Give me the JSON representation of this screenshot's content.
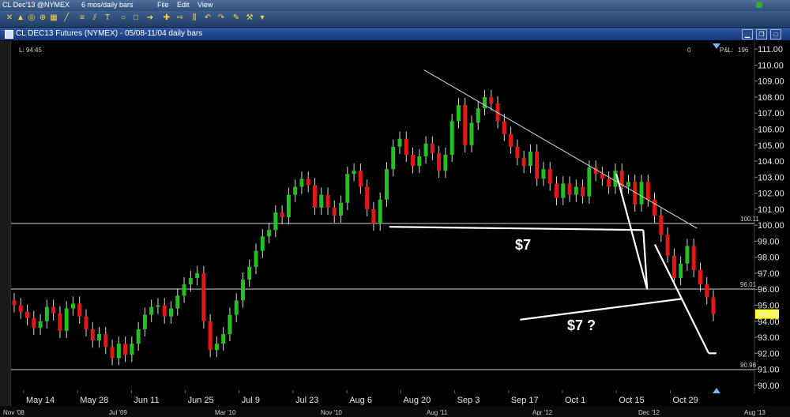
{
  "menubar": {
    "symbol": "CL Dec'13 @NYMEX",
    "period": "6 mos/daily bars",
    "file": "File",
    "edit": "Edit",
    "view": "View"
  },
  "window": {
    "title": "CL DEC13 Futures (NYMEX) - 05/08-11/04 daily bars"
  },
  "info": {
    "last_label": "L: 94.45",
    "zero": "0",
    "pnl_label": "P&L:",
    "pnl_value": "196"
  },
  "timeline": [
    "Nov '08",
    "Jul '09",
    "Mar '10",
    "Nov '10",
    "Aug '11",
    "Apr '12",
    "Dec '12",
    "Aug '13"
  ],
  "annotations": {
    "a1": "$7",
    "a2": "$7 ?"
  },
  "colors": {
    "up": "#22c022",
    "down": "#e01818",
    "last_badge": "#ffff33",
    "trendline": "#bdbdbd"
  },
  "chart_data": {
    "type": "candlestick",
    "title": "CL DEC13 Futures (NYMEX) - 05/08-11/04 daily bars",
    "x_ticks": [
      "May 14",
      "May 28",
      "Jun 11",
      "Jun 25",
      "Jul 9",
      "Jul 23",
      "Aug 6",
      "Aug 20",
      "Sep 3",
      "Sep 17",
      "Oct 1",
      "Oct 15",
      "Oct 29"
    ],
    "y_ticks": [
      "111.00",
      "110.00",
      "109.00",
      "108.00",
      "107.00",
      "106.00",
      "105.00",
      "104.00",
      "103.00",
      "102.00",
      "101.00",
      "100.00",
      "99.00",
      "98.00",
      "97.00",
      "96.00",
      "95.00",
      "94.00",
      "93.00",
      "92.00",
      "91.00",
      "90.00"
    ],
    "ylim": [
      89.5,
      111.5
    ],
    "last": "94.45",
    "hlines": [
      {
        "value": 100.11,
        "label": "100.11"
      },
      {
        "value": 96.01,
        "label": "96.01"
      },
      {
        "value": 90.98,
        "label": "90.98"
      }
    ],
    "closes": [
      95.0,
      94.6,
      94.2,
      93.6,
      94.0,
      94.9,
      94.5,
      93.4,
      94.8,
      95.1,
      94.3,
      93.5,
      92.8,
      93.2,
      92.4,
      91.7,
      92.6,
      91.9,
      92.6,
      93.5,
      94.4,
      94.9,
      95.0,
      94.3,
      94.8,
      95.6,
      96.3,
      96.7,
      97.0,
      94.0,
      92.2,
      92.6,
      93.2,
      94.4,
      95.3,
      96.6,
      97.4,
      98.4,
      99.3,
      99.7,
      100.8,
      100.5,
      101.9,
      102.4,
      102.9,
      102.5,
      101.1,
      101.9,
      101.1,
      100.6,
      101.4,
      103.2,
      103.4,
      102.4,
      101.0,
      100.1,
      101.6,
      103.5,
      104.9,
      105.4,
      104.4,
      103.7,
      104.3,
      105.1,
      104.5,
      103.4,
      104.4,
      106.5,
      107.5,
      105.0,
      106.4,
      107.3,
      108.0,
      107.6,
      106.5,
      105.7,
      104.9,
      104.2,
      103.7,
      104.6,
      102.9,
      103.5,
      102.6,
      101.7,
      102.6,
      101.9,
      102.4,
      101.8,
      103.6,
      103.2,
      102.9,
      102.4,
      103.4,
      102.4,
      102.7,
      101.3,
      102.7,
      101.6,
      100.6,
      99.4,
      98.1,
      96.7,
      97.6,
      98.7,
      97.2,
      96.3,
      95.5,
      94.45
    ],
    "trendlines": [
      {
        "from": [
          "Aug 26",
          109.7
        ],
        "to": [
          "Nov 5",
          99.8
        ]
      },
      {
        "from": [
          "Oct 15",
          103.2
        ],
        "to": [
          "Oct 23",
          96.0
        ]
      },
      {
        "from": [
          "Oct 23",
          96.0
        ],
        "to": [
          "Oct 22",
          99.7
        ]
      },
      {
        "from": [
          "Oct 22",
          99.7
        ],
        "to": [
          "Aug 17",
          99.9
        ]
      },
      {
        "from": [
          "Oct 25",
          98.8
        ],
        "to": [
          "Nov 8",
          92.0
        ]
      },
      {
        "from": [
          "Nov 8",
          92.0
        ],
        "to": [
          "Nov 10",
          92.0
        ]
      },
      {
        "from": [
          "Nov 1",
          95.4
        ],
        "to": [
          "Sep 20",
          94.1
        ]
      }
    ]
  }
}
